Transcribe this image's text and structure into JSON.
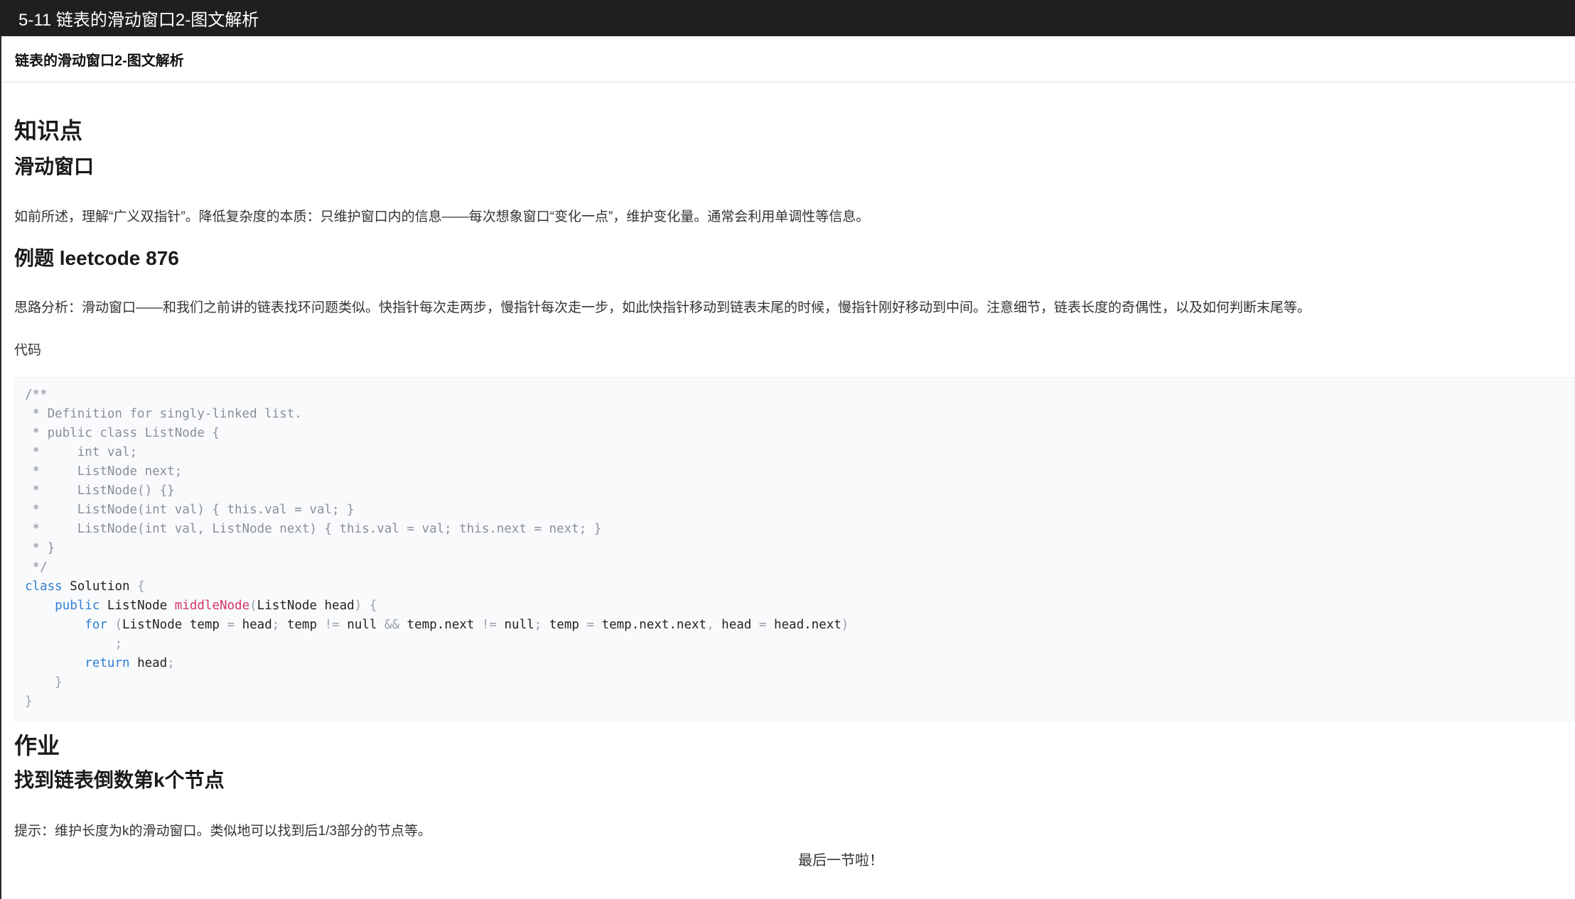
{
  "window": {
    "title": "5-11 链表的滑动窗口2-图文解析"
  },
  "page": {
    "subheader": "链表的滑动窗口2-图文解析",
    "knowledge_heading": "知识点",
    "sliding_heading": "滑动窗口",
    "sliding_text": "如前所述，理解“广义双指针”。降低复杂度的本质：只维护窗口内的信息——每次想象窗口“变化一点”，维护变化量。通常会利用单调性等信息。",
    "example_heading": "例题 leetcode 876",
    "analysis_text": "思路分析：滑动窗口——和我们之前讲的链表找环问题类似。快指针每次走两步，慢指针每次走一步，如此快指针移动到链表末尾的时候，慢指针刚好移动到中间。注意细节，链表长度的奇偶性，以及如何判断末尾等。",
    "code_label": "代码",
    "homework_heading": "作业",
    "findk_heading": "找到链表倒数第k个节点",
    "hint_text": "提示：维护长度为k的滑动窗口。类似地可以找到后1/3部分的节点等。",
    "footer_text": "最后一节啦！"
  },
  "code": {
    "comment_lines": [
      "/**",
      " * Definition for singly-linked list.",
      " * public class ListNode {",
      " *     int val;",
      " *     ListNode next;",
      " *     ListNode() {}",
      " *     ListNode(int val) { this.val = val; }",
      " *     ListNode(int val, ListNode next) { this.val = val; this.next = next; }",
      " * }",
      " */"
    ],
    "kw_class": "class",
    "class_name": "Solution",
    "brace_open": "{",
    "brace_close": "}",
    "kw_public": "public",
    "ret_type": "ListNode",
    "method_name": "middleNode",
    "paren_open": "(",
    "param": "ListNode head",
    "paren_close": ")",
    "kw_for": "for",
    "for_init": "ListNode temp ",
    "eq": "=",
    "head": "head",
    "semi": ";",
    "temp": "temp",
    "neq": "!=",
    "null": "null",
    "and": "&&",
    "temp_next": "temp.next",
    "temp_next_next": "temp.next.next",
    "comma": ",",
    "head_next": "head.next",
    "kw_return": "return"
  }
}
